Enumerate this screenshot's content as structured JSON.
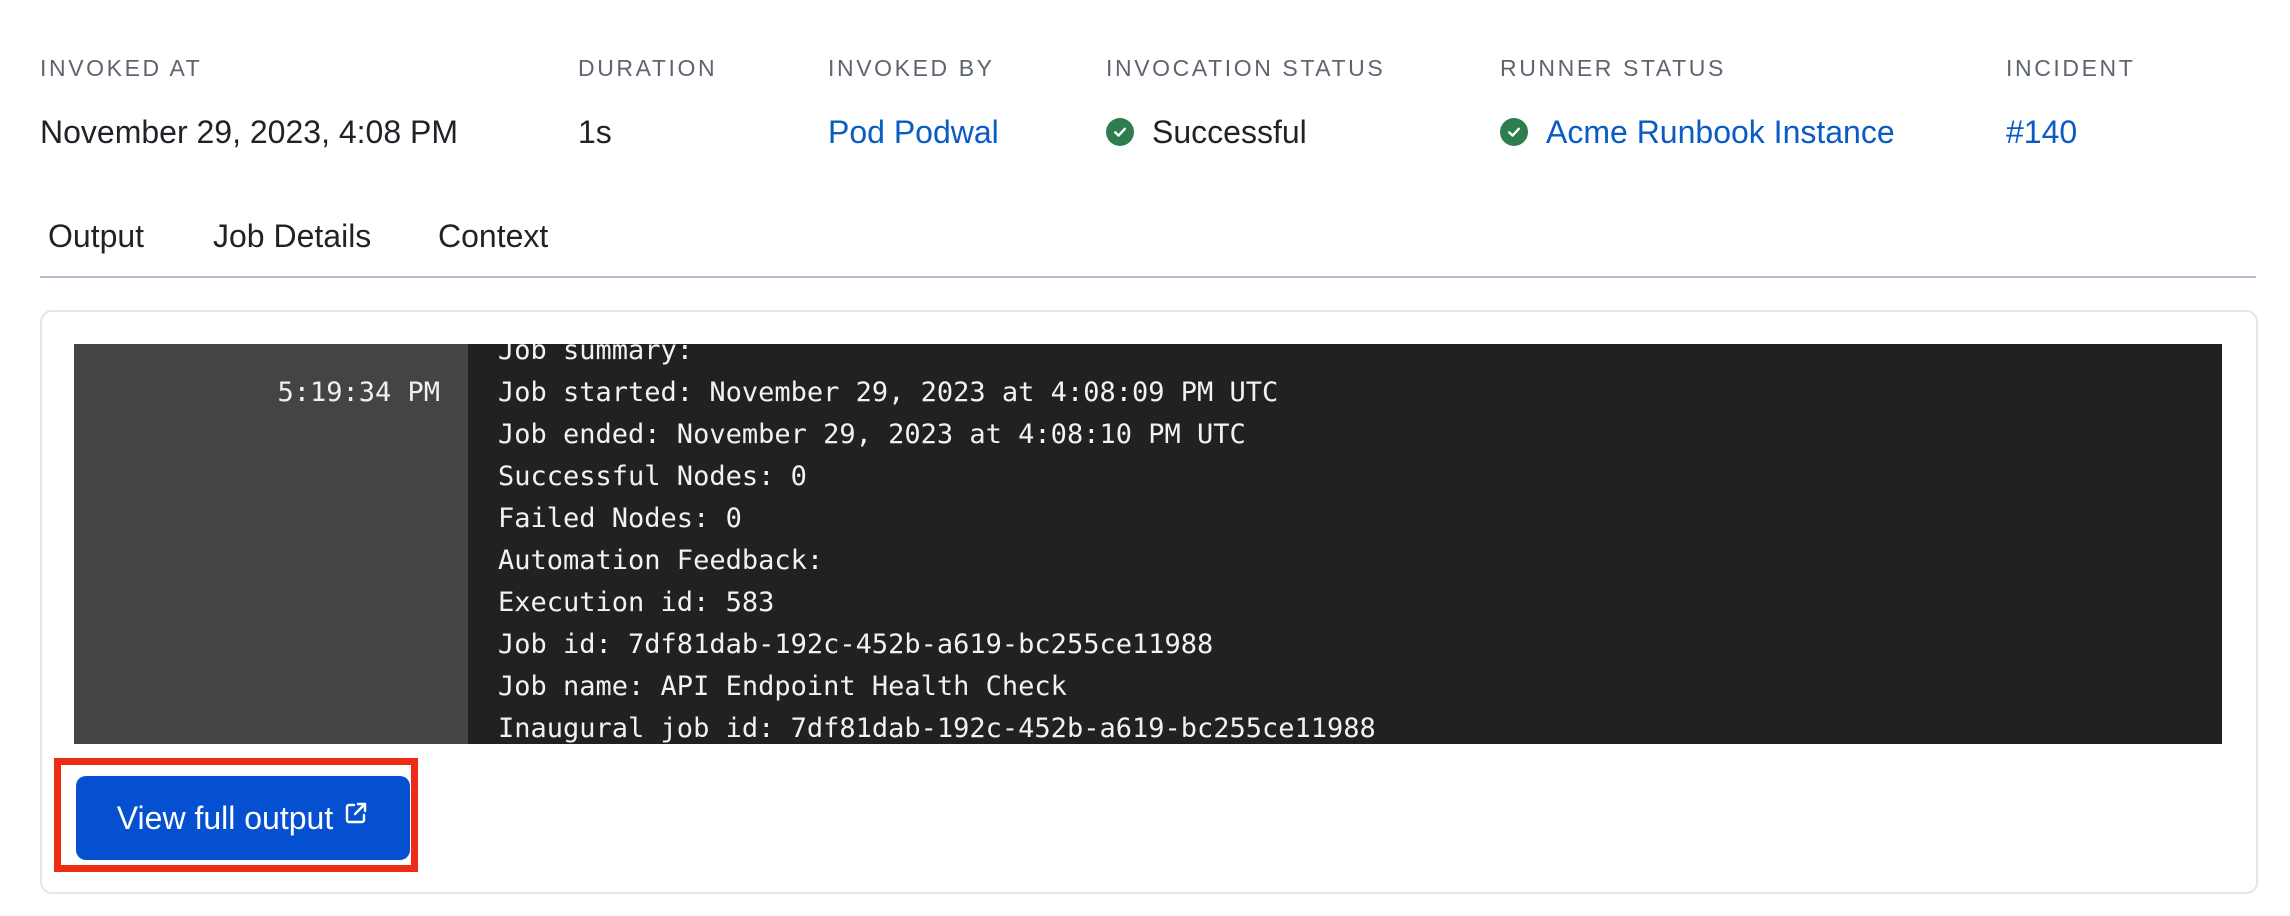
{
  "meta": {
    "invoked_at": {
      "label": "INVOKED AT",
      "value": "November 29, 2023, 4:08 PM"
    },
    "duration": {
      "label": "DURATION",
      "value": "1s"
    },
    "invoked_by": {
      "label": "INVOKED BY",
      "value": "Pod Podwal"
    },
    "invocation_status": {
      "label": "INVOCATION STATUS",
      "value": "Successful",
      "icon": "check-circle-icon",
      "icon_color": "#2e7d4f"
    },
    "runner_status": {
      "label": "RUNNER STATUS",
      "value": "Acme Runbook Instance",
      "icon": "check-circle-icon",
      "icon_color": "#2e7d4f"
    },
    "incident": {
      "label": "INCIDENT",
      "value": "#140"
    }
  },
  "tabs": [
    {
      "label": "Output"
    },
    {
      "label": "Job Details"
    },
    {
      "label": "Context"
    }
  ],
  "output": {
    "timestamp": "5:19:34 PM",
    "lines": [
      "Job summary:",
      "Job started: November 29, 2023 at 4:08:09 PM UTC",
      "Job ended: November 29, 2023 at 4:08:10 PM UTC",
      "Successful Nodes: 0",
      "Failed Nodes: 0",
      "Automation Feedback:",
      "Execution id: 583",
      "Job id: 7df81dab-192c-452b-a619-bc255ce11988",
      "Job name: API Endpoint Health Check",
      "Inaugural job id: 7df81dab-192c-452b-a619-bc255ce11988"
    ],
    "view_full_output_label": "View full output",
    "view_full_output_icon": "external-link-icon"
  },
  "colors": {
    "link": "#0a5bc4",
    "primary_button": "#0550d0",
    "highlight_border": "#ee2b14",
    "terminal_bg": "#212121",
    "terminal_gutter": "#444444"
  }
}
